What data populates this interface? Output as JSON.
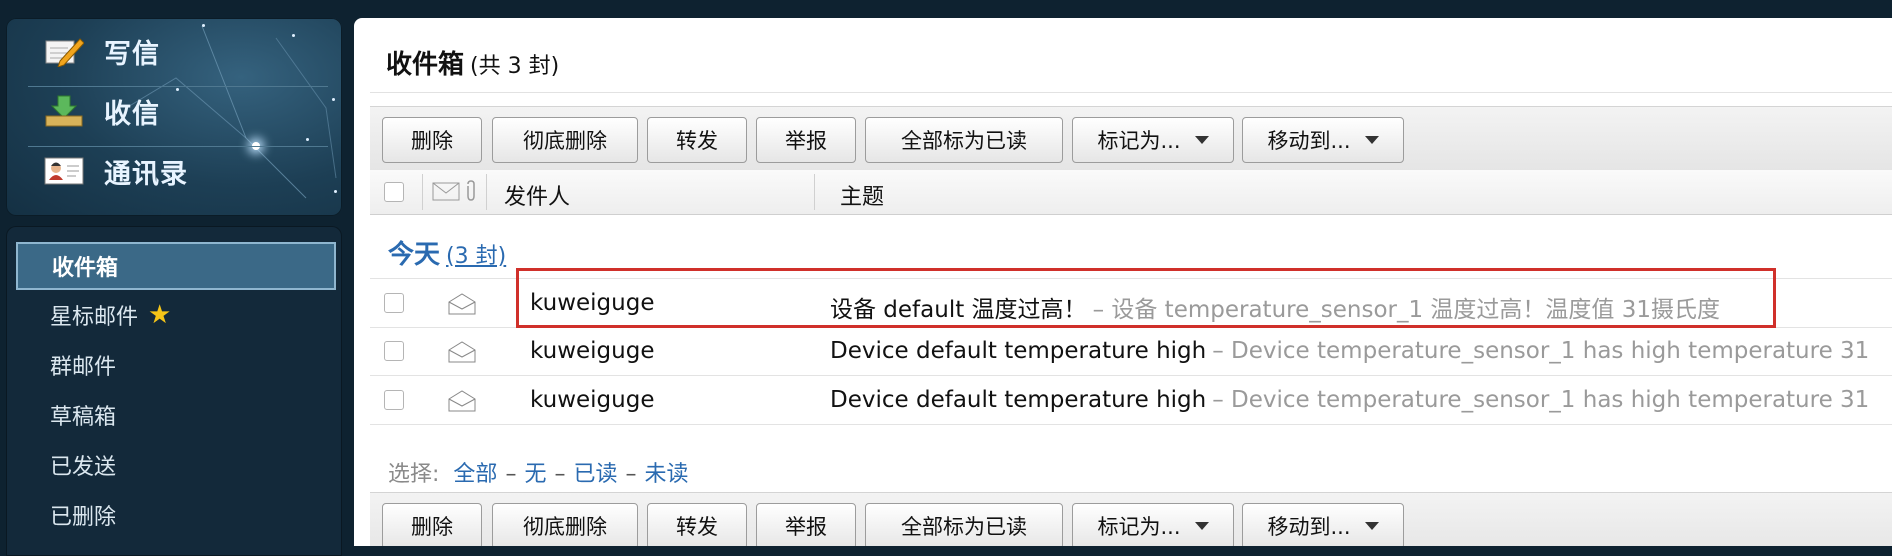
{
  "nav": {
    "compose": "写信",
    "receive": "收信",
    "contacts": "通讯录"
  },
  "folders": [
    {
      "label": "收件箱"
    },
    {
      "label": "星标邮件"
    },
    {
      "label": "群邮件"
    },
    {
      "label": "草稿箱"
    },
    {
      "label": "已发送"
    },
    {
      "label": "已删除"
    }
  ],
  "main": {
    "title": "收件箱",
    "count": "(共 3 封)",
    "toolbar": {
      "delete": "删除",
      "delete_forever": "彻底删除",
      "forward": "转发",
      "report": "举报",
      "mark_all_read": "全部标为已读",
      "mark_as": "标记为...",
      "move_to": "移动到..."
    },
    "columns": {
      "sender": "发件人",
      "subject": "主题"
    },
    "group": {
      "label": "今天",
      "count": "(3 封)"
    },
    "emails": [
      {
        "sender": "kuweiguge",
        "subject": "设备 default 温度过高！",
        "preview": "– 设备 temperature_sensor_1 温度过高！温度值 31摄氏度"
      },
      {
        "sender": "kuweiguge",
        "subject": "Device default temperature high",
        "preview": "– Device temperature_sensor_1 has high temperature 31"
      },
      {
        "sender": "kuweiguge",
        "subject": "Device default temperature high",
        "preview": "– Device temperature_sensor_1 has high temperature 31"
      }
    ],
    "select": {
      "label": "选择:",
      "all": "全部",
      "none": "无",
      "read": "已读",
      "unread": "未读",
      "dash": "–"
    }
  },
  "colors": {
    "accent": "#2a6ab0",
    "highlight": "#d0302a",
    "active_folder": "#3b6987"
  }
}
